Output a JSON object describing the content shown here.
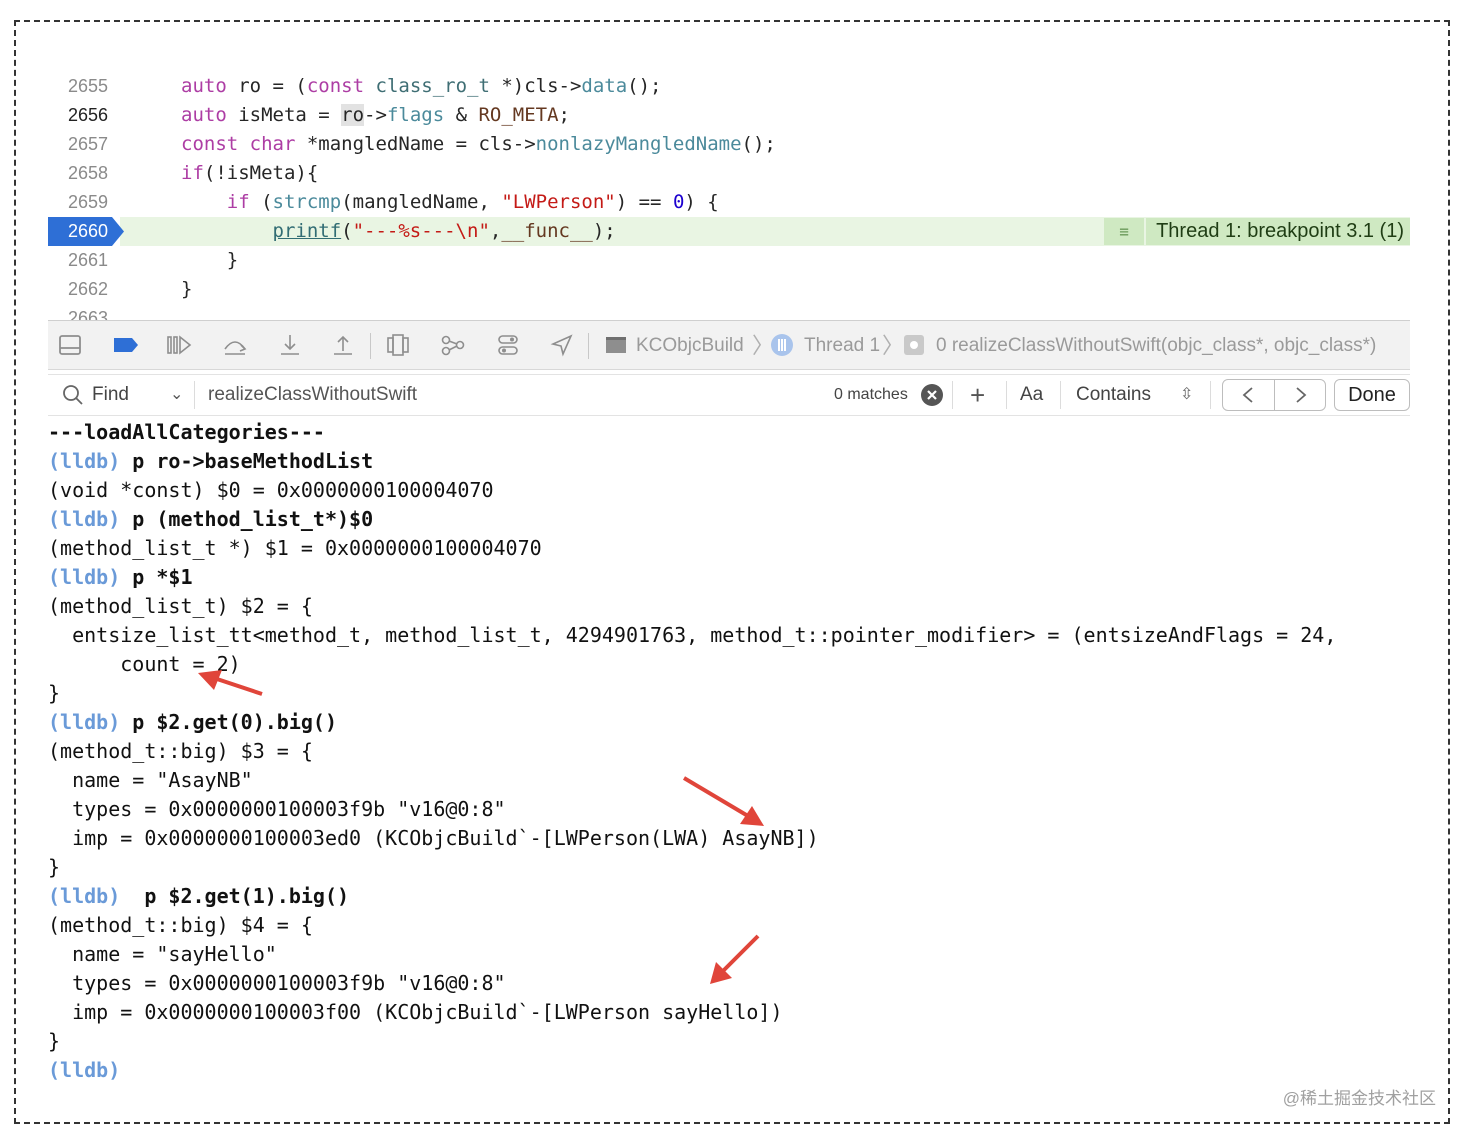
{
  "editor": {
    "lines": [
      {
        "num": "2655",
        "segments": [
          [
            "kw",
            "auto"
          ],
          [
            "p",
            " ro = ("
          ],
          [
            "kw",
            "const"
          ],
          [
            "p",
            " "
          ],
          [
            "ty",
            "class_ro_t"
          ],
          [
            "p",
            " *)cls->"
          ],
          [
            "fn",
            "data"
          ],
          [
            "p",
            "();"
          ]
        ]
      },
      {
        "num": "2656",
        "segments": [
          [
            "kw",
            "auto"
          ],
          [
            "p",
            " isMeta = "
          ],
          [
            "hl",
            "ro"
          ],
          [
            "p",
            "->"
          ],
          [
            "fn",
            "flags"
          ],
          [
            "p",
            " & "
          ],
          [
            "mac",
            "RO_META"
          ],
          [
            "p",
            ";"
          ]
        ]
      },
      {
        "num": "2657",
        "segments": [
          [
            "kw",
            "const"
          ],
          [
            "p",
            " "
          ],
          [
            "kw",
            "char"
          ],
          [
            "p",
            " *mangledName = cls->"
          ],
          [
            "fn",
            "nonlazyMangledName"
          ],
          [
            "p",
            "();"
          ]
        ]
      },
      {
        "num": "2658",
        "segments": [
          [
            "kw",
            "if"
          ],
          [
            "p",
            "(!isMeta){"
          ]
        ]
      },
      {
        "num": "2659",
        "segments": [
          [
            "p",
            "    "
          ],
          [
            "kw",
            "if"
          ],
          [
            "p",
            " ("
          ],
          [
            "fn",
            "strcmp"
          ],
          [
            "p",
            "(mangledName, "
          ],
          [
            "str",
            "\"LWPerson\""
          ],
          [
            "p",
            ") == "
          ],
          [
            "num",
            "0"
          ],
          [
            "p",
            ") {"
          ]
        ]
      },
      {
        "num": "2660",
        "segments": [
          [
            "p",
            "        "
          ],
          [
            "link",
            "printf"
          ],
          [
            "p",
            "("
          ],
          [
            "str",
            "\"---%s---\\n\""
          ],
          [
            "p",
            ","
          ],
          [
            "mac",
            "__func__"
          ],
          [
            "p",
            ");"
          ]
        ]
      },
      {
        "num": "2661",
        "segments": [
          [
            "p",
            "    }"
          ]
        ]
      },
      {
        "num": "2662",
        "segments": [
          [
            "p",
            "}"
          ]
        ]
      },
      {
        "num": "2663",
        "segments": []
      }
    ],
    "breakpoint_line": "2660",
    "breakpoint_label": "Thread 1: breakpoint 3.1 (1)"
  },
  "debug_bar": {
    "breadcrumbs": [
      "KCObjcBuild",
      "Thread 1",
      "0 realizeClassWithoutSwift(objc_class*, objc_class*)"
    ]
  },
  "find_bar": {
    "find_label": "Find",
    "query": "realizeClassWithoutSwift",
    "matches": "0 matches",
    "case_label": "Aa",
    "mode": "Contains",
    "done_label": "Done"
  },
  "console": {
    "lines": [
      {
        "segments": [
          [
            "cmd",
            "---loadAllCategories---"
          ]
        ]
      },
      {
        "segments": [
          [
            "prompt",
            "(lldb)"
          ],
          [
            "cmd",
            " p ro->baseMethodList"
          ]
        ]
      },
      {
        "segments": [
          [
            "p",
            "(void *const) $0 = 0x0000000100004070"
          ]
        ]
      },
      {
        "segments": [
          [
            "prompt",
            "(lldb)"
          ],
          [
            "cmd",
            " p (method_list_t*)$0"
          ]
        ]
      },
      {
        "segments": [
          [
            "p",
            "(method_list_t *) $1 = 0x0000000100004070"
          ]
        ]
      },
      {
        "segments": [
          [
            "prompt",
            "(lldb)"
          ],
          [
            "cmd",
            " p *$1"
          ]
        ]
      },
      {
        "segments": [
          [
            "p",
            "(method_list_t) $2 = {"
          ]
        ]
      },
      {
        "segments": [
          [
            "p",
            "  entsize_list_tt<method_t, method_list_t, 4294901763, method_t::pointer_modifier> = (entsizeAndFlags = 24,"
          ]
        ]
      },
      {
        "segments": [
          [
            "p",
            "      count = 2)"
          ]
        ]
      },
      {
        "segments": [
          [
            "p",
            "}"
          ]
        ]
      },
      {
        "segments": [
          [
            "prompt",
            "(lldb)"
          ],
          [
            "cmd",
            " p $2.get(0).big()"
          ]
        ]
      },
      {
        "segments": [
          [
            "p",
            "(method_t::big) $3 = {"
          ]
        ]
      },
      {
        "segments": [
          [
            "p",
            "  name = \"AsayNB\""
          ]
        ]
      },
      {
        "segments": [
          [
            "p",
            "  types = 0x0000000100003f9b \"v16@0:8\""
          ]
        ]
      },
      {
        "segments": [
          [
            "p",
            "  imp = 0x0000000100003ed0 (KCObjcBuild`-[LWPerson(LWA) AsayNB])"
          ]
        ]
      },
      {
        "segments": [
          [
            "p",
            "}"
          ]
        ]
      },
      {
        "segments": [
          [
            "prompt",
            "(lldb)"
          ],
          [
            "cmd",
            "  p $2.get(1).big()"
          ]
        ]
      },
      {
        "segments": [
          [
            "p",
            "(method_t::big) $4 = {"
          ]
        ]
      },
      {
        "segments": [
          [
            "p",
            "  name = \"sayHello\""
          ]
        ]
      },
      {
        "segments": [
          [
            "p",
            "  types = 0x0000000100003f9b \"v16@0:8\""
          ]
        ]
      },
      {
        "segments": [
          [
            "p",
            "  imp = 0x0000000100003f00 (KCObjcBuild`-[LWPerson sayHello])"
          ]
        ]
      },
      {
        "segments": [
          [
            "p",
            "}"
          ]
        ]
      },
      {
        "segments": [
          [
            "prompt",
            "(lldb)"
          ]
        ]
      }
    ]
  },
  "watermark": "@稀土掘金技术社区",
  "colors": {
    "accent": "#2e6fd6",
    "breakpoint_band": "#e9f5e3",
    "prompt": "#6a9ad8",
    "annotation_arrow": "#e0453a"
  }
}
